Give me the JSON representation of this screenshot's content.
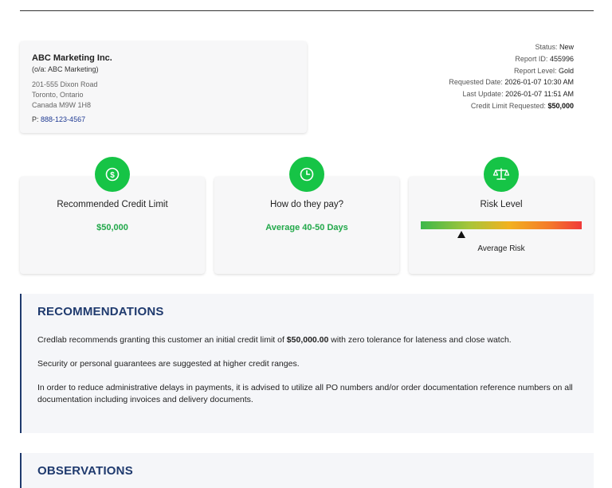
{
  "company": {
    "name": "ABC Marketing Inc.",
    "oa": "(o/a: ABC Marketing)",
    "address_line1": "201-555 Dixon Road",
    "address_line2": "Toronto, Ontario",
    "address_line3": "Canada M9W 1H8",
    "phone_prefix": "P:",
    "phone": "888-123-4567"
  },
  "report_meta": {
    "status_label": "Status:",
    "status_value": "New",
    "report_id_label": "Report ID:",
    "report_id_value": "455996",
    "report_level_label": "Report Level:",
    "report_level_value": "Gold",
    "requested_date_label": "Requested Date:",
    "requested_date_value": "2026-01-07 10:30 AM",
    "last_update_label": "Last Update:",
    "last_update_value": "2026-01-07 11:51 AM",
    "credit_limit_label": "Credit Limit Requested:",
    "credit_limit_value": "$50,000"
  },
  "summary_cards": {
    "credit": {
      "title": "Recommended Credit Limit",
      "value": "$50,000",
      "icon": "dollar-icon"
    },
    "payment": {
      "title": "How do they pay?",
      "value": "Average 40-50 Days",
      "icon": "clock-icon"
    },
    "risk": {
      "title": "Risk Level",
      "level_label": "Average Risk",
      "icon": "scales-icon",
      "marker_position": 0.25
    }
  },
  "colors": {
    "accent_green": "#16c446",
    "value_green": "#22a84a",
    "heading_navy": "#1f3a6e",
    "link_blue": "#1f3a93"
  },
  "recommendations": {
    "heading": "RECOMMENDATIONS",
    "p1_before": "Credlab recommends granting this customer an initial credit limit of ",
    "p1_amount": "$50,000.00",
    "p1_after": " with zero tolerance for lateness and close watch.",
    "p2": "Security or personal guarantees are suggested at higher credit ranges.",
    "p3": "In order to reduce administrative delays in payments, it is advised to utilize all PO numbers and/or order documentation reference numbers on all documentation including invoices and delivery documents."
  },
  "observations": {
    "heading": "OBSERVATIONS"
  }
}
